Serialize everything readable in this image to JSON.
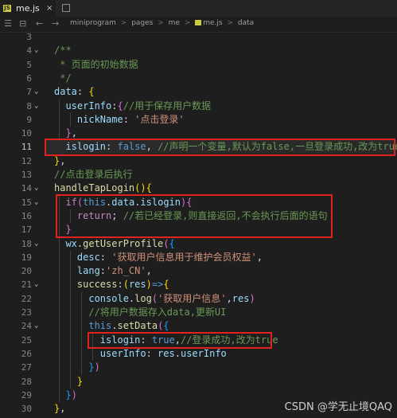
{
  "tab": {
    "filename": "me.js",
    "icon_text": "JS",
    "close_glyph": "×"
  },
  "breadcrumb": {
    "items": [
      "miniprogram",
      "pages",
      "me",
      "me.js",
      "data"
    ],
    "separator": ">"
  },
  "toolbar": {
    "menu_glyph": "☰",
    "bookmark_glyph": "⊟",
    "back_glyph": "←",
    "forward_glyph": "→"
  },
  "editor": {
    "current_line": 11,
    "lines": [
      {
        "n": 3,
        "fold": "",
        "tokens": []
      },
      {
        "n": 4,
        "fold": "v",
        "tokens": [
          {
            "t": "/**",
            "c": "c-cmt"
          }
        ]
      },
      {
        "n": 5,
        "fold": "",
        "tokens": [
          {
            "t": " * 页面的初始数据",
            "c": "c-cmt"
          }
        ]
      },
      {
        "n": 6,
        "fold": "",
        "tokens": [
          {
            "t": " */",
            "c": "c-cmt"
          }
        ]
      },
      {
        "n": 7,
        "fold": "v",
        "tokens": [
          {
            "t": "data",
            "c": "c-var"
          },
          {
            "t": ": ",
            "c": "c-plain"
          },
          {
            "t": "{",
            "c": "c-brk1"
          }
        ]
      },
      {
        "n": 8,
        "fold": "v",
        "tokens": [
          {
            "t": "  userInfo",
            "c": "c-var"
          },
          {
            "t": ":",
            "c": "c-plain"
          },
          {
            "t": "{",
            "c": "c-brk2"
          },
          {
            "t": "//用于保存用户数据",
            "c": "c-cmt"
          }
        ]
      },
      {
        "n": 9,
        "fold": "",
        "tokens": [
          {
            "t": "    nickName",
            "c": "c-var"
          },
          {
            "t": ": ",
            "c": "c-plain"
          },
          {
            "t": "'点击登录'",
            "c": "c-str"
          }
        ]
      },
      {
        "n": 10,
        "fold": "",
        "tokens": [
          {
            "t": "  ",
            "c": "c-plain"
          },
          {
            "t": "}",
            "c": "c-brk2"
          },
          {
            "t": ",",
            "c": "c-plain"
          }
        ]
      },
      {
        "n": 11,
        "fold": "",
        "tokens": [
          {
            "t": "  islogin",
            "c": "c-var"
          },
          {
            "t": ": ",
            "c": "c-plain"
          },
          {
            "t": "false",
            "c": "c-kw"
          },
          {
            "t": ", ",
            "c": "c-plain"
          },
          {
            "t": "//声明一个变量,默认为false,一旦登录成功,改为true",
            "c": "c-cmt"
          }
        ]
      },
      {
        "n": 12,
        "fold": "",
        "tokens": [
          {
            "t": "}",
            "c": "c-brk1"
          },
          {
            "t": ",",
            "c": "c-plain"
          }
        ]
      },
      {
        "n": 13,
        "fold": "",
        "tokens": [
          {
            "t": "//点击登录后执行",
            "c": "c-cmt"
          }
        ]
      },
      {
        "n": 14,
        "fold": "v",
        "tokens": [
          {
            "t": "handleTapLogin",
            "c": "c-fn"
          },
          {
            "t": "()",
            "c": "c-brk1"
          },
          {
            "t": "{",
            "c": "c-brk1"
          }
        ]
      },
      {
        "n": 15,
        "fold": "v",
        "tokens": [
          {
            "t": "  if",
            "c": "c-ctl"
          },
          {
            "t": "(",
            "c": "c-brk2"
          },
          {
            "t": "this",
            "c": "c-kw"
          },
          {
            "t": ".",
            "c": "c-plain"
          },
          {
            "t": "data",
            "c": "c-var"
          },
          {
            "t": ".",
            "c": "c-plain"
          },
          {
            "t": "islogin",
            "c": "c-var"
          },
          {
            "t": ")",
            "c": "c-brk2"
          },
          {
            "t": "{",
            "c": "c-brk2"
          }
        ]
      },
      {
        "n": 16,
        "fold": "",
        "tokens": [
          {
            "t": "    return",
            "c": "c-ctl"
          },
          {
            "t": "; ",
            "c": "c-plain"
          },
          {
            "t": "//若已经登录,则直接返回,不会执行后面的语句",
            "c": "c-cmt"
          }
        ]
      },
      {
        "n": 17,
        "fold": "",
        "tokens": [
          {
            "t": "  }",
            "c": "c-brk2"
          }
        ]
      },
      {
        "n": 18,
        "fold": "v",
        "tokens": [
          {
            "t": "  wx",
            "c": "c-var"
          },
          {
            "t": ".",
            "c": "c-plain"
          },
          {
            "t": "getUserProfile",
            "c": "c-fn"
          },
          {
            "t": "(",
            "c": "c-brk2"
          },
          {
            "t": "{",
            "c": "c-brk3"
          }
        ]
      },
      {
        "n": 19,
        "fold": "",
        "tokens": [
          {
            "t": "    desc",
            "c": "c-var"
          },
          {
            "t": ": ",
            "c": "c-plain"
          },
          {
            "t": "'获取用户信息用于维护会员权益'",
            "c": "c-str"
          },
          {
            "t": ",",
            "c": "c-plain"
          }
        ]
      },
      {
        "n": 20,
        "fold": "",
        "tokens": [
          {
            "t": "    lang",
            "c": "c-var"
          },
          {
            "t": ":",
            "c": "c-plain"
          },
          {
            "t": "'zh_CN'",
            "c": "c-str"
          },
          {
            "t": ",",
            "c": "c-plain"
          }
        ]
      },
      {
        "n": 21,
        "fold": "v",
        "tokens": [
          {
            "t": "    success",
            "c": "c-fn"
          },
          {
            "t": ":",
            "c": "c-plain"
          },
          {
            "t": "(",
            "c": "c-brk1"
          },
          {
            "t": "res",
            "c": "c-var"
          },
          {
            "t": ")",
            "c": "c-brk1"
          },
          {
            "t": "=>",
            "c": "c-kw"
          },
          {
            "t": "{",
            "c": "c-brk1"
          }
        ]
      },
      {
        "n": 22,
        "fold": "",
        "tokens": [
          {
            "t": "      console",
            "c": "c-var"
          },
          {
            "t": ".",
            "c": "c-plain"
          },
          {
            "t": "log",
            "c": "c-fn"
          },
          {
            "t": "(",
            "c": "c-brk2"
          },
          {
            "t": "'获取用户信息'",
            "c": "c-str"
          },
          {
            "t": ",",
            "c": "c-plain"
          },
          {
            "t": "res",
            "c": "c-var"
          },
          {
            "t": ")",
            "c": "c-brk2"
          }
        ]
      },
      {
        "n": 23,
        "fold": "",
        "tokens": [
          {
            "t": "      //将用户数据存入data,更新UI",
            "c": "c-cmt"
          }
        ]
      },
      {
        "n": 24,
        "fold": "v",
        "tokens": [
          {
            "t": "      this",
            "c": "c-kw"
          },
          {
            "t": ".",
            "c": "c-plain"
          },
          {
            "t": "setData",
            "c": "c-fn"
          },
          {
            "t": "(",
            "c": "c-brk2"
          },
          {
            "t": "{",
            "c": "c-brk3"
          }
        ]
      },
      {
        "n": 25,
        "fold": "",
        "tokens": [
          {
            "t": "        islogin",
            "c": "c-var"
          },
          {
            "t": ": ",
            "c": "c-plain"
          },
          {
            "t": "true",
            "c": "c-kw"
          },
          {
            "t": ",",
            "c": "c-plain"
          },
          {
            "t": "//登录成功,改为true",
            "c": "c-cmt"
          }
        ]
      },
      {
        "n": 26,
        "fold": "",
        "tokens": [
          {
            "t": "        userInfo",
            "c": "c-var"
          },
          {
            "t": ": ",
            "c": "c-plain"
          },
          {
            "t": "res",
            "c": "c-var"
          },
          {
            "t": ".",
            "c": "c-plain"
          },
          {
            "t": "userInfo",
            "c": "c-var"
          }
        ]
      },
      {
        "n": 27,
        "fold": "",
        "tokens": [
          {
            "t": "      }",
            "c": "c-brk3"
          },
          {
            "t": ")",
            "c": "c-brk2"
          }
        ]
      },
      {
        "n": 28,
        "fold": "",
        "tokens": [
          {
            "t": "    }",
            "c": "c-brk1"
          }
        ]
      },
      {
        "n": 29,
        "fold": "",
        "tokens": [
          {
            "t": "  }",
            "c": "c-brk3"
          },
          {
            "t": ")",
            "c": "c-brk2"
          }
        ]
      },
      {
        "n": 30,
        "fold": "",
        "tokens": [
          {
            "t": "}",
            "c": "c-brk1"
          },
          {
            "t": ",",
            "c": "c-plain"
          }
        ]
      }
    ]
  },
  "watermark": "CSDN @学无止境QAQ",
  "colors": {
    "highlight_box": "#e0231f",
    "background": "#1e1e1e"
  }
}
